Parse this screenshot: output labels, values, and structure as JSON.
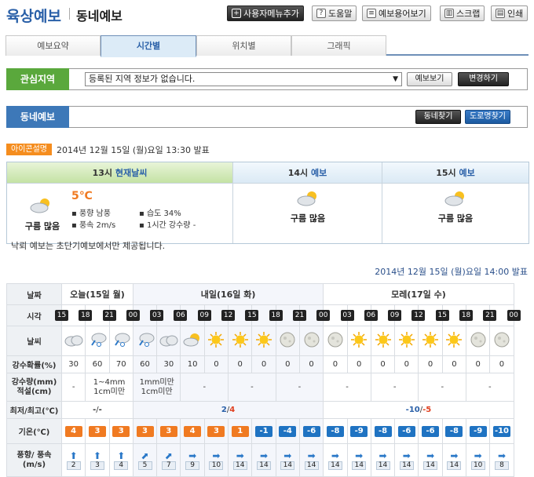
{
  "header": {
    "title": "육상예보",
    "subtitle": "동네예보"
  },
  "toolbar": [
    {
      "label": "사용자메뉴추가",
      "icon": "plus-icon",
      "style": "dark"
    },
    {
      "label": "도움말",
      "icon": "question-icon"
    },
    {
      "label": "예보용어보기",
      "icon": "book-icon"
    },
    {
      "label": "스크랩",
      "icon": "trash-icon"
    },
    {
      "label": "인쇄",
      "icon": "print-icon"
    }
  ],
  "tabs": [
    {
      "label": "예보요약"
    },
    {
      "label": "시간별",
      "active": true
    },
    {
      "label": "위치별"
    },
    {
      "label": "그래픽"
    }
  ],
  "region": {
    "label": "관심지역",
    "selected": "등록된 지역 정보가 없습니다.",
    "view_btn": "예보보기",
    "change_btn": "변경하기"
  },
  "dong": {
    "label": "동네예보",
    "find_btn": "동네찾기",
    "road_btn": "도로명찾기"
  },
  "icon_badge": "아이콘설명",
  "issue_time": "2014년 12월 15일 (월)요일 13:30 발표",
  "current": {
    "col1": {
      "hour": "13시",
      "tag": "현재날씨",
      "desc": "구름 많음",
      "temp": "5℃",
      "wind_dir": "풍향 남풍",
      "wind_speed": "풍속 2m/s",
      "humidity": "습도 34%",
      "rain": "1시간 강수량 -"
    },
    "col2": {
      "hour": "14시",
      "tag": "예보",
      "desc": "구름 많음"
    },
    "col3": {
      "hour": "15시",
      "tag": "예보",
      "desc": "구름 많음"
    }
  },
  "note": "낙뢰 예보는 초단기예보에서만 제공됩니다.",
  "issue_time2": "2014년 12월 15일 (월)요일 14:00 발표",
  "table": {
    "row_labels": {
      "date": "날짜",
      "time": "시각",
      "weather": "날씨",
      "prob": "강수확률(%)",
      "amount": "강수량(mm) 적설(cm)",
      "minmax": "최저/최고(℃)",
      "temp": "기온(℃)",
      "wind": "풍향/ 풍속(m/s)"
    },
    "days": [
      {
        "label": "오늘(15일 월)",
        "span": 3
      },
      {
        "label": "내일(16일 화)",
        "span": 8
      },
      {
        "label": "모레(17일 수)",
        "span": 8
      }
    ],
    "hours": [
      "15",
      "18",
      "21",
      "00",
      "03",
      "06",
      "09",
      "12",
      "15",
      "18",
      "21",
      "00",
      "03",
      "06",
      "09",
      "12",
      "15",
      "18",
      "21",
      "00"
    ],
    "weather": [
      "cloud",
      "snow",
      "snow",
      "snow",
      "cloud",
      "partly",
      "sun",
      "sun",
      "sun",
      "moon",
      "moon",
      "moon",
      "sun",
      "sun",
      "sun",
      "sun",
      "sun",
      "moon",
      "moon"
    ],
    "prob": [
      "30",
      "60",
      "70",
      "60",
      "30",
      "10",
      "0",
      "0",
      "0",
      "0",
      "0",
      "0",
      "0",
      "0",
      "0",
      "0",
      "0",
      "0",
      "0"
    ],
    "amount": [
      {
        "text": "-",
        "span": 1
      },
      {
        "text": "1~4mm 1cm미만",
        "span": 2
      },
      {
        "text": "1mm미만 1cm미만",
        "span": 2
      },
      {
        "text": "-",
        "span": 2
      },
      {
        "text": "-",
        "span": 2
      },
      {
        "text": "-",
        "span": 2
      },
      {
        "text": "-",
        "span": 2
      },
      {
        "text": "-",
        "span": 2
      },
      {
        "text": "-",
        "span": 2
      },
      {
        "text": "-",
        "span": 2
      }
    ],
    "minmax": [
      {
        "min": "-",
        "max": "-",
        "span": 3
      },
      {
        "min": "2",
        "max": "4",
        "span": 8
      },
      {
        "min": "-10",
        "max": "-5",
        "span": 8
      }
    ],
    "temps": [
      "4",
      "3",
      "3",
      "3",
      "3",
      "4",
      "3",
      "1",
      "-1",
      "-4",
      "-6",
      "-8",
      "-9",
      "-8",
      "-6",
      "-6",
      "-8",
      "-9",
      "-10"
    ],
    "wind_dir": [
      "up",
      "up",
      "up",
      "ne",
      "ne",
      "right",
      "right",
      "right",
      "right",
      "right",
      "right",
      "right",
      "right",
      "right",
      "right",
      "right",
      "right",
      "right",
      "right"
    ],
    "wind_speed": [
      "2",
      "3",
      "4",
      "5",
      "7",
      "9",
      "10",
      "14",
      "14",
      "14",
      "14",
      "14",
      "14",
      "14",
      "14",
      "14",
      "14",
      "10",
      "8"
    ]
  },
  "colors": {
    "accent_blue": "#2a60a8",
    "green": "#5aa83c",
    "orange": "#f07a21",
    "blue_temp": "#1f73c2"
  }
}
